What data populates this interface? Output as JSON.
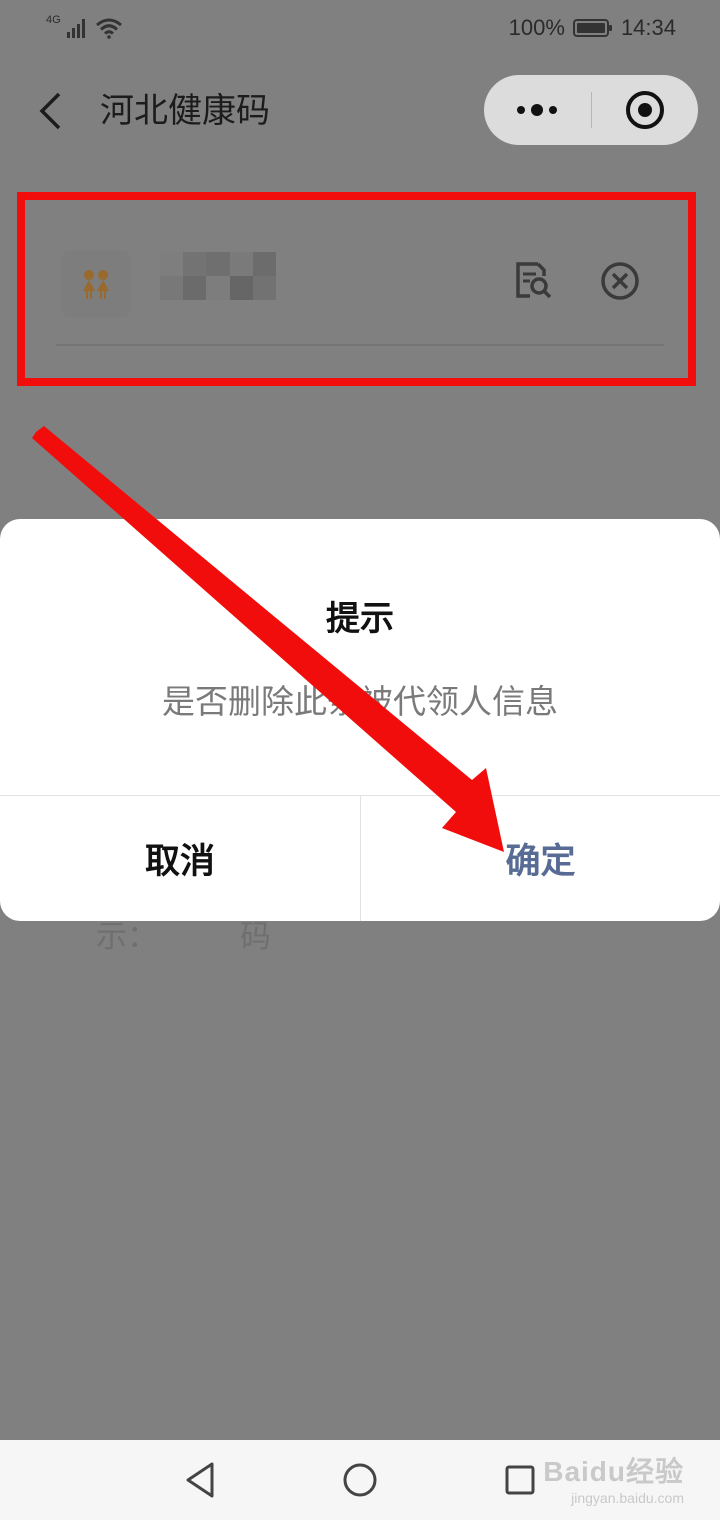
{
  "status_bar": {
    "network": "4G",
    "battery": "100%",
    "time": "14:34"
  },
  "nav": {
    "title": "河北健康码"
  },
  "tips": {
    "label": "温馨提示：",
    "text": "最多为5位被代领人代领健康码"
  },
  "dialog": {
    "title": "提示",
    "message": "是否删除此条被代领人信息",
    "cancel_label": "取消",
    "confirm_label": "确定"
  },
  "watermark": {
    "brand": "Baidu经验",
    "url": "jingyan.baidu.com"
  },
  "colors": {
    "highlight": "#f20d0d",
    "confirm": "#576b95",
    "overlay": "#808080"
  },
  "icons": [
    "signal-icon",
    "wifi-icon",
    "battery-icon",
    "back-arrow-icon",
    "more-dots-icon",
    "close-target-icon",
    "children-avatar-icon",
    "detail-search-icon",
    "remove-circle-x-icon",
    "android-back-icon",
    "android-home-icon",
    "android-recent-icon"
  ]
}
